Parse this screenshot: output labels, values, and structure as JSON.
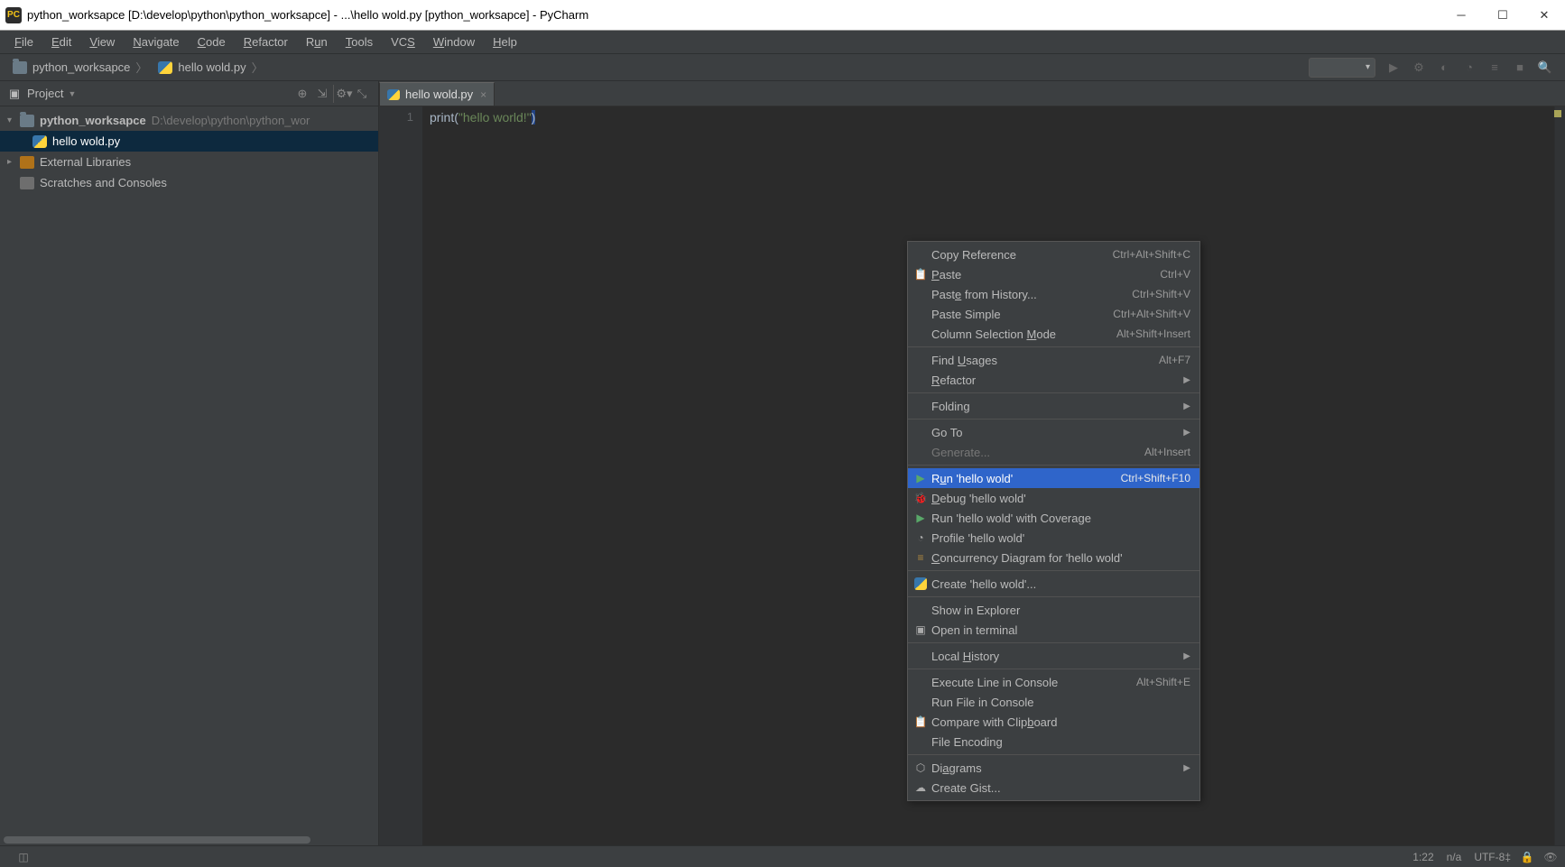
{
  "window": {
    "title": "python_worksapce [D:\\develop\\python\\python_worksapce] - ...\\hello wold.py [python_worksapce] - PyCharm"
  },
  "menubar": [
    {
      "label": "File",
      "ul": "F"
    },
    {
      "label": "Edit",
      "ul": "E"
    },
    {
      "label": "View",
      "ul": "V"
    },
    {
      "label": "Navigate",
      "ul": "N"
    },
    {
      "label": "Code",
      "ul": "C"
    },
    {
      "label": "Refactor",
      "ul": "R"
    },
    {
      "label": "Run",
      "ul": "u"
    },
    {
      "label": "Tools",
      "ul": "T"
    },
    {
      "label": "VCS",
      "ul": "S"
    },
    {
      "label": "Window",
      "ul": "W"
    },
    {
      "label": "Help",
      "ul": "H"
    }
  ],
  "breadcrumb": {
    "seg1": "python_worksapce",
    "seg2": "hello wold.py"
  },
  "sidebar": {
    "title": "Project",
    "tree": {
      "root_name": "python_worksapce",
      "root_path": "D:\\develop\\python\\python_wor",
      "file": "hello wold.py",
      "ext_libs": "External Libraries",
      "scratches": "Scratches and Consoles"
    }
  },
  "editor": {
    "tab_label": "hello wold.py",
    "gutter_line": "1",
    "code_fn": "print",
    "code_str": "\"hello world!\""
  },
  "context_menu": [
    {
      "type": "item",
      "label": "Copy Reference",
      "shortcut": "Ctrl+Alt+Shift+C"
    },
    {
      "type": "item",
      "icon": "paste",
      "label_pre": "",
      "ul": "P",
      "label_post": "aste",
      "shortcut": "Ctrl+V"
    },
    {
      "type": "item",
      "label_pre": "Past",
      "ul": "e",
      "label_post": " from History...",
      "shortcut": "Ctrl+Shift+V"
    },
    {
      "type": "item",
      "label": "Paste Simple",
      "shortcut": "Ctrl+Alt+Shift+V"
    },
    {
      "type": "item",
      "label_pre": "Column Selection ",
      "ul": "M",
      "label_post": "ode",
      "shortcut": "Alt+Shift+Insert"
    },
    {
      "type": "sep"
    },
    {
      "type": "item",
      "label_pre": "Find ",
      "ul": "U",
      "label_post": "sages",
      "shortcut": "Alt+F7"
    },
    {
      "type": "item",
      "label_pre": "",
      "ul": "R",
      "label_post": "efactor",
      "submenu": true
    },
    {
      "type": "sep"
    },
    {
      "type": "item",
      "label": "Folding",
      "submenu": true
    },
    {
      "type": "sep"
    },
    {
      "type": "item",
      "label": "Go To",
      "submenu": true
    },
    {
      "type": "item",
      "disabled": true,
      "label": "Generate...",
      "shortcut": "Alt+Insert"
    },
    {
      "type": "sep"
    },
    {
      "type": "item",
      "highlight": true,
      "icon": "run",
      "label_pre": "R",
      "ul": "u",
      "label_post": "n 'hello wold'",
      "shortcut": "Ctrl+Shift+F10"
    },
    {
      "type": "item",
      "icon": "bug",
      "label_pre": "",
      "ul": "D",
      "label_post": "ebug 'hello wold'"
    },
    {
      "type": "item",
      "icon": "cov",
      "label": "Run 'hello wold' with Coverage"
    },
    {
      "type": "item",
      "icon": "prof",
      "label": "Profile 'hello wold'"
    },
    {
      "type": "item",
      "icon": "conc",
      "label_pre": "",
      "ul": "C",
      "label_post": "oncurrency Diagram for 'hello wold'"
    },
    {
      "type": "sep"
    },
    {
      "type": "item",
      "icon": "py",
      "label": "Create 'hello wold'..."
    },
    {
      "type": "sep"
    },
    {
      "type": "item",
      "label": "Show in Explorer"
    },
    {
      "type": "item",
      "icon": "term",
      "label": "Open in terminal"
    },
    {
      "type": "sep"
    },
    {
      "type": "item",
      "label_pre": "Local ",
      "ul": "H",
      "label_post": "istory",
      "submenu": true
    },
    {
      "type": "sep"
    },
    {
      "type": "item",
      "label": "Execute Line in Console",
      "shortcut": "Alt+Shift+E"
    },
    {
      "type": "item",
      "label": "Run File in Console"
    },
    {
      "type": "item",
      "icon": "paste",
      "label_pre": "Compare with Clip",
      "ul": "b",
      "label_post": "oard"
    },
    {
      "type": "item",
      "label": "File Encoding"
    },
    {
      "type": "sep"
    },
    {
      "type": "item",
      "icon": "diag",
      "label_pre": "Di",
      "ul": "a",
      "label_post": "grams",
      "submenu": true
    },
    {
      "type": "item",
      "icon": "gist",
      "label": "Create Gist..."
    }
  ],
  "statusbar": {
    "position": "1:22",
    "insert_mode": "n/a",
    "encoding": "UTF-8"
  }
}
